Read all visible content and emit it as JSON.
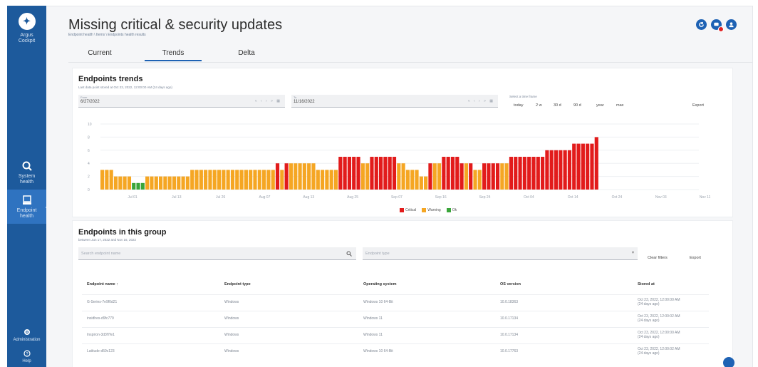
{
  "sidebar": {
    "app_name_line1": "Argus",
    "app_name_line2": "Cockpit",
    "items": [
      {
        "label_line1": "System",
        "label_line2": "health"
      },
      {
        "label_line1": "Endpoint",
        "label_line2": "health"
      },
      {
        "label_line1": "Administration",
        "label_line2": ""
      },
      {
        "label_line1": "Help",
        "label_line2": ""
      }
    ]
  },
  "header": {
    "title": "Missing critical & security updates",
    "breadcrumb": "Endpoint health \\ Items \\ Endpoints health results"
  },
  "tabs": [
    "Current",
    "Trends",
    "Delta"
  ],
  "trends": {
    "title": "Endpoints trends",
    "subtitle": "Last data point stored at Oct 23, 2022, 12:00:00 AM (24 days ago)",
    "from_label": "From",
    "from_value": "6/27/2022",
    "to_label": "To",
    "to_value": "11/16/2022",
    "range_label": "Select a time frame",
    "ranges": [
      "today",
      "2 w",
      "30 d",
      "90 d",
      "year",
      "max"
    ],
    "export_label": "Export"
  },
  "chart_data": {
    "type": "bar",
    "stacked": false,
    "x_ticks": [
      "Jul 01",
      "Jul 13",
      "Jul 26",
      "Aug 07",
      "Aug 13",
      "Aug 25",
      "Sep 07",
      "Sep 16",
      "Sep 24",
      "Oct 04",
      "Oct 14",
      "Oct 24",
      "Nov 03",
      "Nov 11"
    ],
    "y_ticks": [
      0,
      2,
      4,
      6,
      8,
      10
    ],
    "ylim": [
      0,
      10
    ],
    "legend": [
      {
        "name": "Critical",
        "color": "#e21b1b"
      },
      {
        "name": "Warning",
        "color": "#f5a623"
      },
      {
        "name": "Ok",
        "color": "#3aa53a"
      }
    ],
    "legend_position": "bottom-center",
    "values": [
      3,
      3,
      3,
      2,
      2,
      2,
      2,
      1,
      1,
      1,
      2,
      2,
      2,
      2,
      2,
      2,
      2,
      2,
      2,
      2,
      3,
      3,
      3,
      3,
      3,
      3,
      3,
      3,
      3,
      3,
      3,
      3,
      3,
      3,
      3,
      3,
      3,
      3,
      3,
      4,
      3,
      4,
      4,
      4,
      4,
      4,
      4,
      4,
      3,
      3,
      3,
      3,
      3,
      5,
      5,
      5,
      5,
      5,
      4,
      4,
      5,
      5,
      5,
      5,
      5,
      5,
      4,
      4,
      3,
      3,
      3,
      2,
      2,
      4,
      4,
      4,
      5,
      5,
      5,
      5,
      4,
      4,
      4,
      3,
      3,
      4,
      4,
      4,
      4,
      4,
      4,
      5,
      5,
      5,
      5,
      5,
      5,
      5,
      5,
      6,
      6,
      6,
      6,
      6,
      6,
      7,
      7,
      7,
      7,
      7,
      8
    ],
    "status": [
      "W",
      "W",
      "W",
      "W",
      "W",
      "W",
      "W",
      "O",
      "O",
      "O",
      "W",
      "W",
      "W",
      "W",
      "W",
      "W",
      "W",
      "W",
      "W",
      "W",
      "W",
      "W",
      "W",
      "W",
      "W",
      "W",
      "W",
      "W",
      "W",
      "W",
      "W",
      "W",
      "W",
      "W",
      "W",
      "W",
      "W",
      "W",
      "W",
      "C",
      "W",
      "C",
      "W",
      "W",
      "W",
      "W",
      "W",
      "W",
      "W",
      "W",
      "W",
      "W",
      "W",
      "C",
      "C",
      "C",
      "C",
      "C",
      "W",
      "W",
      "C",
      "C",
      "C",
      "C",
      "C",
      "C",
      "W",
      "W",
      "W",
      "W",
      "W",
      "W",
      "W",
      "C",
      "W",
      "W",
      "C",
      "C",
      "C",
      "C",
      "C",
      "W",
      "C",
      "W",
      "W",
      "C",
      "C",
      "C",
      "C",
      "W",
      "W",
      "C",
      "C",
      "C",
      "C",
      "C",
      "C",
      "C",
      "C",
      "C",
      "C",
      "C",
      "C",
      "C",
      "C",
      "C",
      "C",
      "C",
      "C",
      "C",
      "C"
    ]
  },
  "group": {
    "title": "Endpoints in this group",
    "subtitle": "between Jun 17, 2022 and Nov 16, 2022",
    "search_placeholder": "Search endpoint name",
    "type_placeholder": "Endpoint type",
    "clear_label": "Clear filters",
    "export_label": "Export",
    "columns": [
      "Endpoint name",
      "Endpoint type",
      "Operating system",
      "OS version",
      "Stored at"
    ],
    "rows": [
      {
        "name": "G-Series-7e9f0d21",
        "type": "Windows",
        "os": "Windows 10 64-Bit",
        "ver": "10.0.18363",
        "stored1": "Oct 23, 2022, 12:00:00 AM",
        "stored2": "(24 days ago)"
      },
      {
        "name": "insidhes-d9fc779",
        "type": "Windows",
        "os": "Windows 11",
        "ver": "10.0.17134",
        "stored1": "Oct 23, 2022, 12:00:02 AM",
        "stored2": "(24 days ago)"
      },
      {
        "name": "Inspiron-3d3f7fe1",
        "type": "Windows",
        "os": "Windows 11",
        "ver": "10.0.17134",
        "stored1": "Oct 23, 2022, 12:00:00 AM",
        "stored2": "(24 days ago)"
      },
      {
        "name": "Latitude-d59c123",
        "type": "Windows",
        "os": "Windows 10 64-Bit",
        "ver": "10.0.17763",
        "stored1": "Oct 23, 2022, 12:00:02 AM",
        "stored2": "(24 days ago)"
      }
    ]
  }
}
